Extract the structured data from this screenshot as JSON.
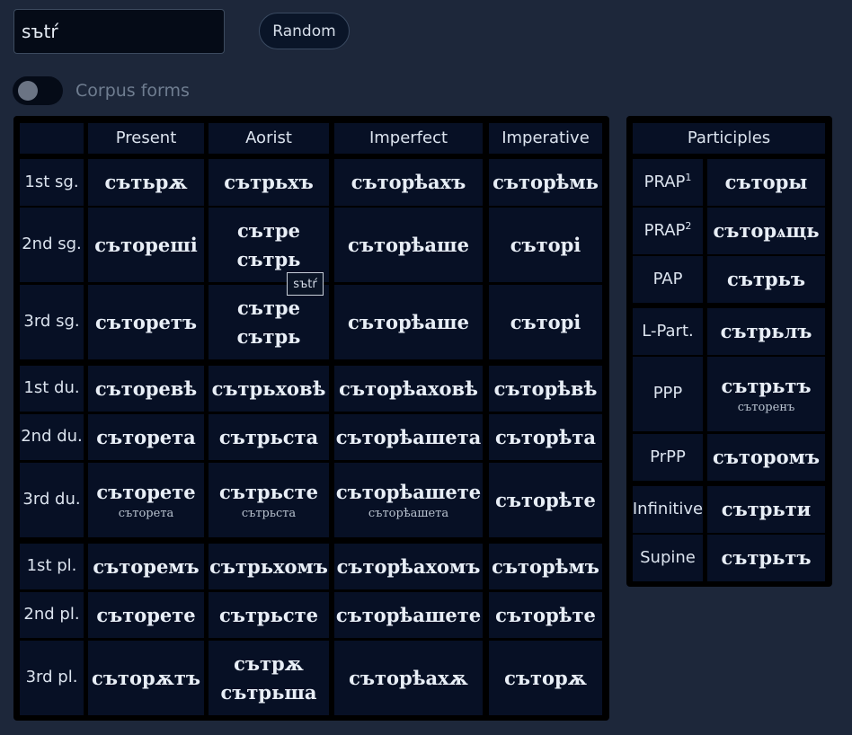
{
  "search": {
    "value": "sъtŕ"
  },
  "random_label": "Random",
  "toggle": {
    "label": "Corpus forms"
  },
  "tooltip": "sъtŕ",
  "verb": {
    "headers": [
      "Present",
      "Aorist",
      "Imperfect",
      "Imperative"
    ],
    "rows": [
      {
        "label": "1st sg.",
        "cells": [
          [
            "сътьрѫ"
          ],
          [
            "сътрьхъ"
          ],
          [
            "съторѣахъ"
          ],
          [
            "съторѣмь"
          ]
        ]
      },
      {
        "label": "2nd sg.",
        "cells": [
          [
            "съторешi"
          ],
          [
            "сътре",
            "сътрь"
          ],
          [
            "съторѣаше"
          ],
          [
            "съторi"
          ]
        ]
      },
      {
        "label": "3rd sg.",
        "cells": [
          [
            "съторетъ"
          ],
          [
            "сътре",
            "сътрь"
          ],
          [
            "съторѣаше"
          ],
          [
            "съторi"
          ]
        ]
      },
      {
        "label": "1st du.",
        "cells": [
          [
            "съторевѣ"
          ],
          [
            "сътрьховѣ"
          ],
          [
            "съторѣаховѣ"
          ],
          [
            "съторѣвѣ"
          ]
        ]
      },
      {
        "label": "2nd du.",
        "cells": [
          [
            "съторета"
          ],
          [
            "сътрьста"
          ],
          [
            "съторѣашета"
          ],
          [
            "съторѣта"
          ]
        ]
      },
      {
        "label": "3rd du.",
        "cells": [
          [
            "съторете",
            "съторета"
          ],
          [
            "сътрьсте",
            "сътрьста"
          ],
          [
            "съторѣашете",
            "съторѣашета"
          ],
          [
            "съторѣте"
          ]
        ]
      },
      {
        "label": "1st pl.",
        "cells": [
          [
            "съторемъ"
          ],
          [
            "сътрьхомъ"
          ],
          [
            "съторѣахомъ"
          ],
          [
            "съторѣмъ"
          ]
        ]
      },
      {
        "label": "2nd pl.",
        "cells": [
          [
            "съторете"
          ],
          [
            "сътрьсте"
          ],
          [
            "съторѣашете"
          ],
          [
            "съторѣте"
          ]
        ]
      },
      {
        "label": "3rd pl.",
        "cells": [
          [
            "съторѫтъ"
          ],
          [
            "сътрѫ",
            "сътрьша"
          ],
          [
            "съторѣахѫ"
          ],
          [
            "съторѫ"
          ]
        ]
      }
    ]
  },
  "participles": {
    "header": "Participles",
    "rows": [
      {
        "label": "PRAP",
        "sup": "1",
        "forms": [
          "съторы"
        ]
      },
      {
        "label": "PRAP",
        "sup": "2",
        "forms": [
          "съторѧщь"
        ]
      },
      {
        "label": "PAP",
        "sup": "",
        "forms": [
          "сътрьъ"
        ]
      },
      {
        "label": "L-Part.",
        "sup": "",
        "forms": [
          "сътрьлъ"
        ]
      },
      {
        "label": "PPP",
        "sup": "",
        "forms": [
          "сътрьтъ",
          "съторенъ"
        ]
      },
      {
        "label": "PrPP",
        "sup": "",
        "forms": [
          "съторомъ"
        ]
      },
      {
        "label": "Infinitive",
        "sup": "",
        "forms": [
          "сътрьти"
        ]
      },
      {
        "label": "Supine",
        "sup": "",
        "forms": [
          "сътрьтъ"
        ]
      }
    ]
  }
}
